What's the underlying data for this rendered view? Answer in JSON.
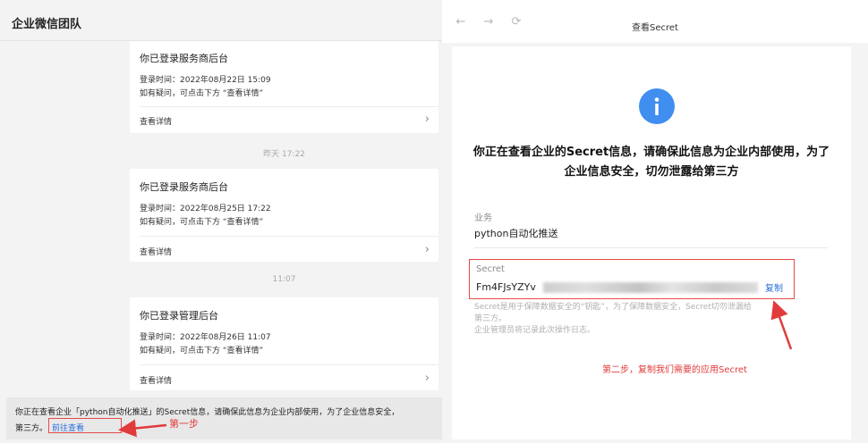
{
  "left": {
    "title": "企业微信团队",
    "cards": [
      {
        "title": "你已登录服务商后台",
        "login_time": "登录时间：2022年08月22日 15:09",
        "hint": "如有疑问，可点击下方 “查看详情”",
        "link": "查看详情"
      },
      {
        "title": "你已登录服务商后台",
        "login_time": "登录时间：2022年08月25日 17:22",
        "hint": "如有疑问，可点击下方 “查看详情”",
        "link": "查看详情"
      },
      {
        "title": "你已登录管理后台",
        "login_time": "登录时间：2022年08月26日 11:07",
        "hint": "如有疑问，可点击下方 “查看详情”",
        "link": "查看详情"
      }
    ],
    "time_separators": [
      "昨天 17:22",
      "11:07"
    ],
    "notice": {
      "line1": "你正在查看企业「python自动化推送」的Secret信息，请确保此信息为企业内部使用，为了企业信息安全，",
      "line2_prefix": "第三方。",
      "goto_link": "前往查看"
    },
    "step1_label": "第一步"
  },
  "right": {
    "title": "查看Secret",
    "nav": {
      "back": "←",
      "forward": "→",
      "refresh": "⟳"
    },
    "warning": "你正在查看企业的Secret信息，请确保此信息为企业内部使用，为了企业信息安全，切勿泄露给第三方",
    "biz_label": "业务",
    "biz_value": "python自动化推送",
    "secret_label": "Secret",
    "secret_value": "Fm4FJsYZYv",
    "copy_label": "复制",
    "secret_desc_1": "Secret是用于保障数据安全的“钥匙”，为了保障数据安全，Secret切勿泄漏给",
    "secret_desc_2": "第三方。",
    "secret_desc_3": "企业管理员将记录此次操作日志。",
    "step2_label": "第二步，复制我们需要的应用Secret",
    "colors": {
      "accent_blue": "#3f8ef0",
      "annotation_red": "#e23b3b"
    }
  }
}
